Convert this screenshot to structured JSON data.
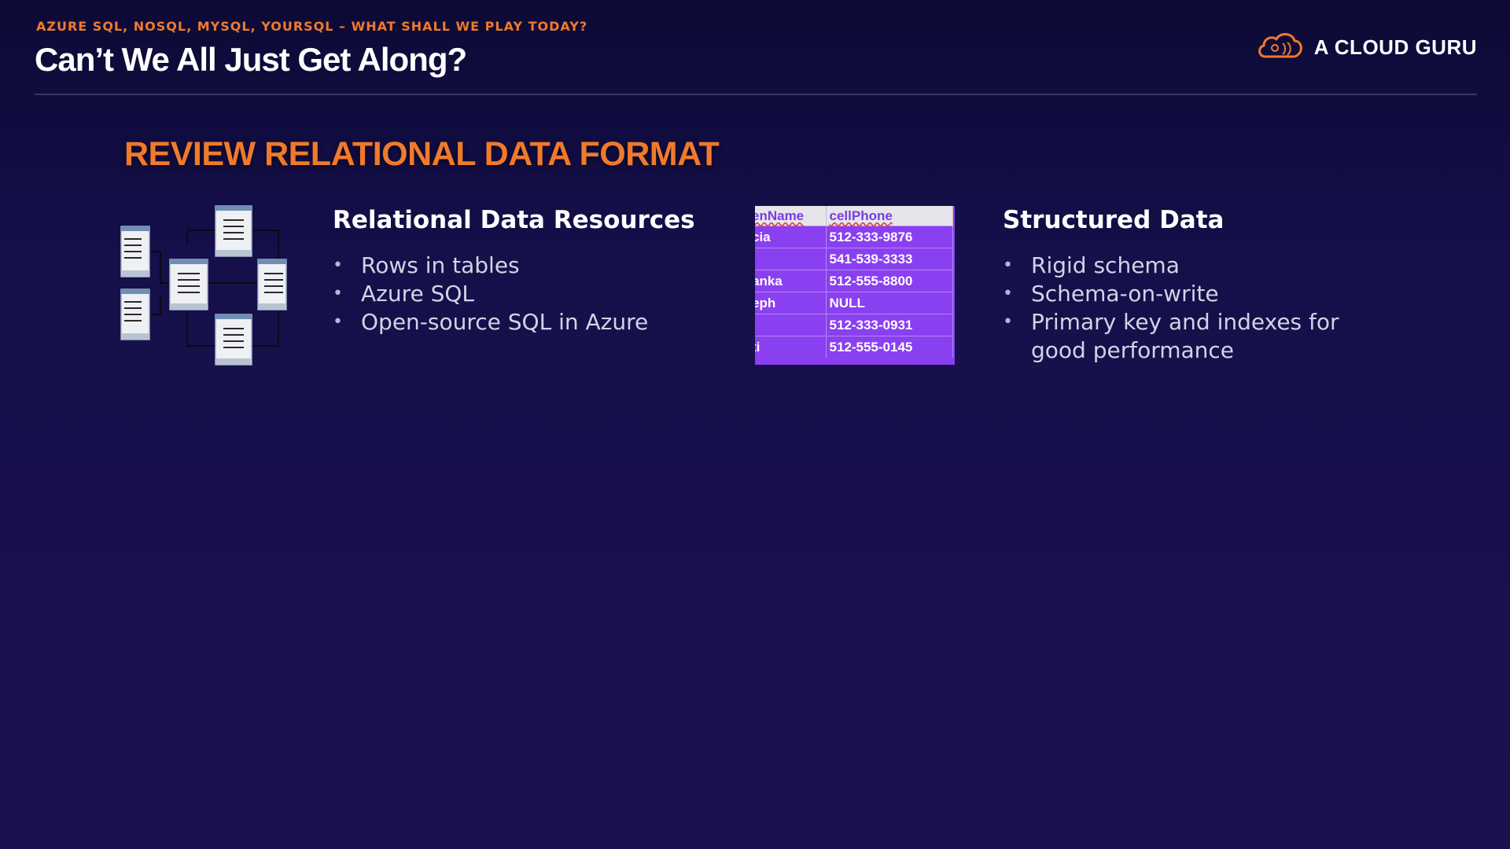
{
  "header": {
    "kicker": "AZURE SQL, NOSQL, MYSQL, YOURSQL – WHAT SHALL WE PLAY TODAY?",
    "title": "Can’t We All Just Get Along?",
    "brand": "A CLOUD GURU",
    "brand_icon": "cloud-logo-icon"
  },
  "section": {
    "heading": "REVIEW RELATIONAL DATA FORMAT"
  },
  "left_column": {
    "icon": "relational-tables-diagram-icon",
    "heading": "Relational Data Resources",
    "bullets": [
      "Rows in tables",
      "Azure SQL",
      "Open-source SQL in Azure"
    ]
  },
  "table": {
    "columns": [
      "enName",
      "cellPhone"
    ],
    "rows": [
      [
        "cia",
        "512-333-9876"
      ],
      [
        "",
        "541-539-3333"
      ],
      [
        "anka",
        "512-555-8800"
      ],
      [
        "eph",
        "NULL"
      ],
      [
        ":",
        "512-333-0931"
      ],
      [
        "ti",
        "512-555-0145"
      ]
    ]
  },
  "right_column": {
    "heading": "Structured Data",
    "bullets": [
      "Rigid schema",
      "Schema-on-write",
      "Primary key and indexes for good performance"
    ]
  },
  "colors": {
    "accent": "#f07a2c",
    "background": "#150f4a",
    "table_fill": "#8a3ff0"
  }
}
